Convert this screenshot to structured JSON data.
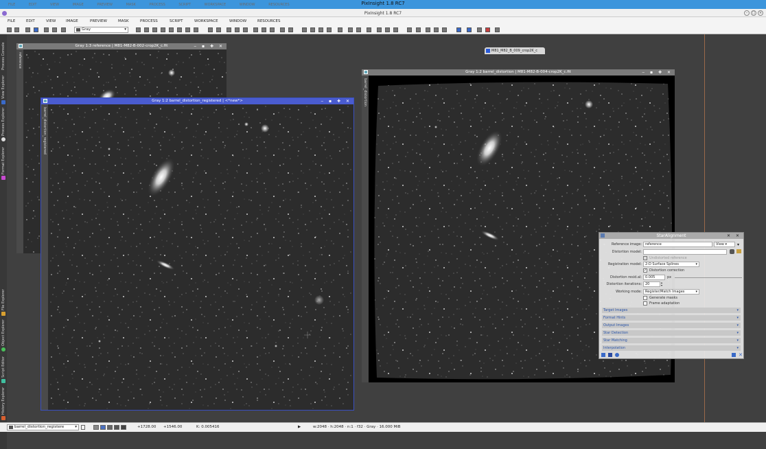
{
  "app": {
    "title": "PixInsight 1.8 RC7",
    "ghost_menu": "FILE EDIT VIEW IMAGE PREVIEW MASK PROCESS SCRIPT WORKSPACE WINDOW RESOURCES"
  },
  "menu": [
    "FILE",
    "EDIT",
    "VIEW",
    "IMAGE",
    "PREVIEW",
    "MASK",
    "PROCESS",
    "SCRIPT",
    "WORKSPACE",
    "WINDOW",
    "RESOURCES"
  ],
  "toolbar": {
    "color_space": "Gray"
  },
  "left_dock": [
    "Process Console",
    "View Explorer",
    "Process Explorer",
    "Format Explorer",
    "File Explorer",
    "Object Explorer",
    "Script Editor",
    "History Explorer"
  ],
  "windows": {
    "reference": {
      "title": "Gray 1:3 reference | M81-M82-B-002-crop2K_c.fit",
      "side_label": "reference"
    },
    "registered": {
      "title": "Gray 1:2 barrel_distortion_registered | <*new*>",
      "side_label": "barrel_distortion_registered"
    },
    "distortion": {
      "title": "Gray 1:2 barrel_distortion | M81-M82-B-004-crop2K_c.fit",
      "side_label": "barrel_distortion"
    },
    "controls": "‒ ▪ ✚ ✕"
  },
  "iconized": {
    "label": "M81_M82_B_009_crop2K_c"
  },
  "star_alignment": {
    "title": "StarAlignment",
    "reference_image_label": "Reference image:",
    "reference_image_value": "reference",
    "view_button": "View",
    "distortion_model_label": "Distortion model:",
    "undistorted_reference": "Undistorted reference",
    "registration_model_label": "Registration model:",
    "registration_model_value": "2-D Surface Splines",
    "distortion_correction": "Distortion correction",
    "distortion_resid_label": "Distortion resid.al:",
    "distortion_resid_value": "0.005",
    "distortion_resid_unit": "px",
    "distortion_iter_label": "Distortion iterations:",
    "distortion_iter_value": "20",
    "working_mode_label": "Working mode:",
    "working_mode_value": "Register/Match Images",
    "generate_masks": "Generate masks",
    "frame_adaptation": "Frame adaptation",
    "sections": [
      "Target Images",
      "Format Hints",
      "Output Images",
      "Star Detection",
      "Star Matching",
      "Interpolation"
    ]
  },
  "status": {
    "view": "barrel_distortion_registere",
    "x": "+1728.00",
    "y": "+1546.00",
    "k": "K: 0.005416",
    "play": "▶",
    "info": "w:2048 · h:2048 · n:1 · f32 · Gray · 16.000 MiB"
  }
}
